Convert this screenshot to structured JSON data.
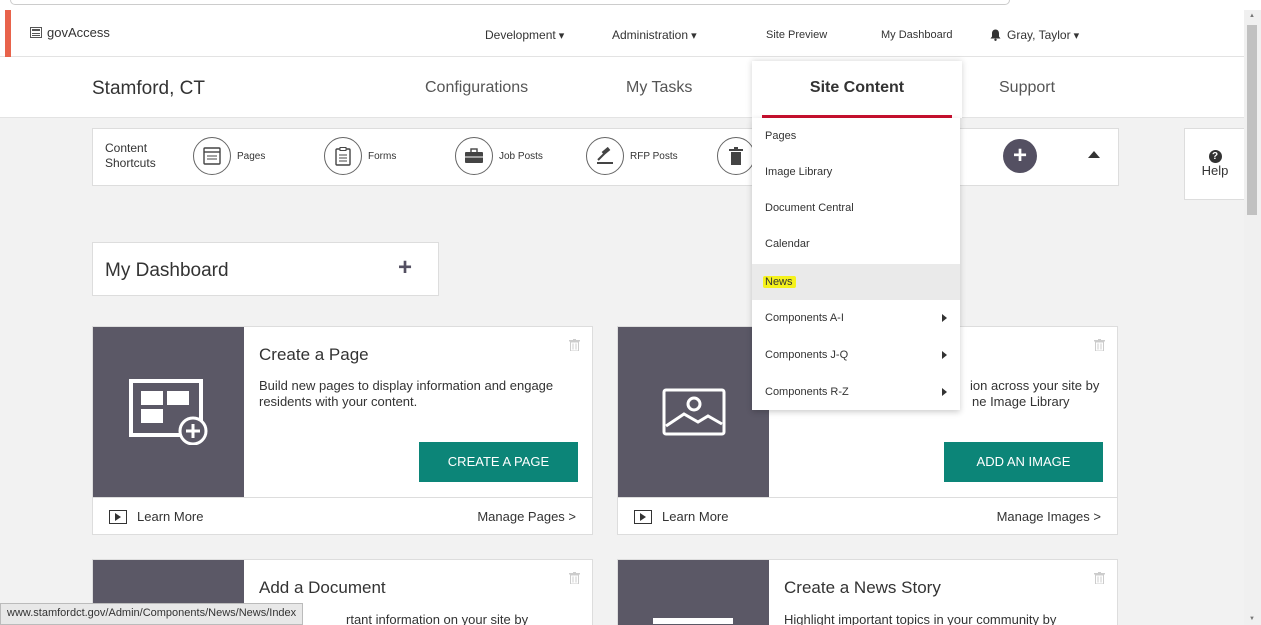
{
  "adminbar": {
    "brand": "govAccess",
    "development": "Development",
    "administration": "Administration",
    "site_preview": "Site Preview",
    "my_dashboard": "My Dashboard",
    "user": "Gray, Taylor"
  },
  "mainnav": {
    "site_name": "Stamford, CT",
    "tabs": [
      "Configurations",
      "My Tasks",
      "Site Content",
      "Support"
    ]
  },
  "shortcuts": {
    "label_line1": "Content",
    "label_line2": "Shortcuts",
    "items": [
      "Pages",
      "Forms",
      "Job Posts",
      "RFP Posts"
    ]
  },
  "help": {
    "label": "Help",
    "icon": "?"
  },
  "dashboard": {
    "title": "My Dashboard",
    "add": "+"
  },
  "cards": [
    {
      "title": "Create a Page",
      "desc": "Build new pages to display information and engage residents with your content.",
      "cta": "CREATE A PAGE",
      "learn": "Learn More",
      "manage": "Manage Pages >"
    },
    {
      "desc": "ion across your site by",
      "desc2": "ne Image Library",
      "cta": "ADD AN IMAGE",
      "learn": "Learn More",
      "manage": "Manage Images >"
    },
    {
      "title": "Add a Document",
      "desc": "rtant information on your site by"
    },
    {
      "title": "Create a News Story",
      "desc": "Highlight important topics in your community by"
    }
  ],
  "dropdown": {
    "items": [
      "Pages",
      "Image Library",
      "Document Central",
      "Calendar",
      "News",
      "Components A-I",
      "Components J-Q",
      "Components R-Z"
    ]
  },
  "status_url": "www.stamfordct.gov/Admin/Components/News/News/Index",
  "colors": {
    "accent": "#e8634b",
    "cta": "#0c8578",
    "thumb": "#5b5866",
    "active_underline": "#c8102e",
    "highlight": "#f5f21c"
  }
}
